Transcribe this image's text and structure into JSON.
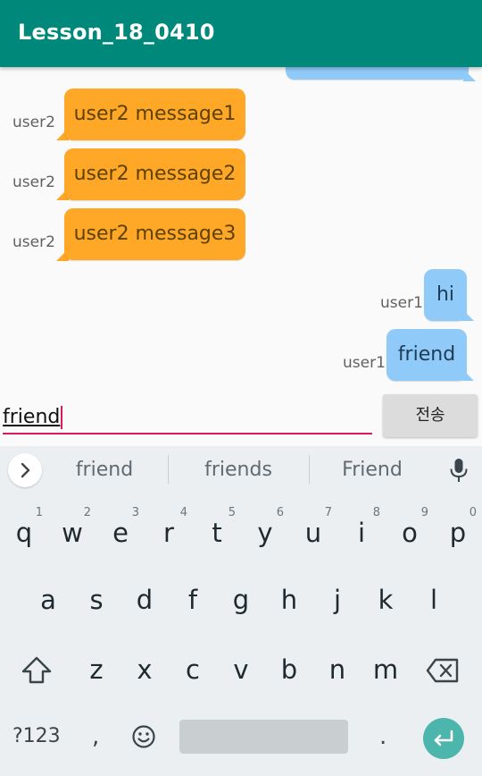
{
  "app": {
    "title": "Lesson_18_0410"
  },
  "messages": [
    {
      "sender": "user1",
      "text": "",
      "side": "right",
      "partial": true
    },
    {
      "sender": "user2",
      "text": "user2 message1",
      "side": "left"
    },
    {
      "sender": "user2",
      "text": "user2 message2",
      "side": "left"
    },
    {
      "sender": "user2",
      "text": "user2 message3",
      "side": "left"
    },
    {
      "sender": "user1",
      "text": "hi",
      "side": "right"
    },
    {
      "sender": "user1",
      "text": "friend",
      "side": "right"
    }
  ],
  "input": {
    "value": "friend",
    "send_label": "전송"
  },
  "suggestions": [
    "friend",
    "friends",
    "Friend"
  ],
  "keyboard": {
    "row1": [
      "q",
      "w",
      "e",
      "r",
      "t",
      "y",
      "u",
      "i",
      "o",
      "p"
    ],
    "row1_hints": [
      "1",
      "2",
      "3",
      "4",
      "5",
      "6",
      "7",
      "8",
      "9",
      "0"
    ],
    "row2": [
      "a",
      "s",
      "d",
      "f",
      "g",
      "h",
      "j",
      "k",
      "l"
    ],
    "row3": [
      "z",
      "x",
      "c",
      "v",
      "b",
      "n",
      "m"
    ],
    "symbols_label": "?123",
    "comma": ",",
    "period": "."
  },
  "colors": {
    "appbar": "#00897b",
    "user2_bubble": "#ffa726",
    "user1_bubble": "#90caf9",
    "accent": "#d81b60",
    "enter": "#4db6ac"
  }
}
